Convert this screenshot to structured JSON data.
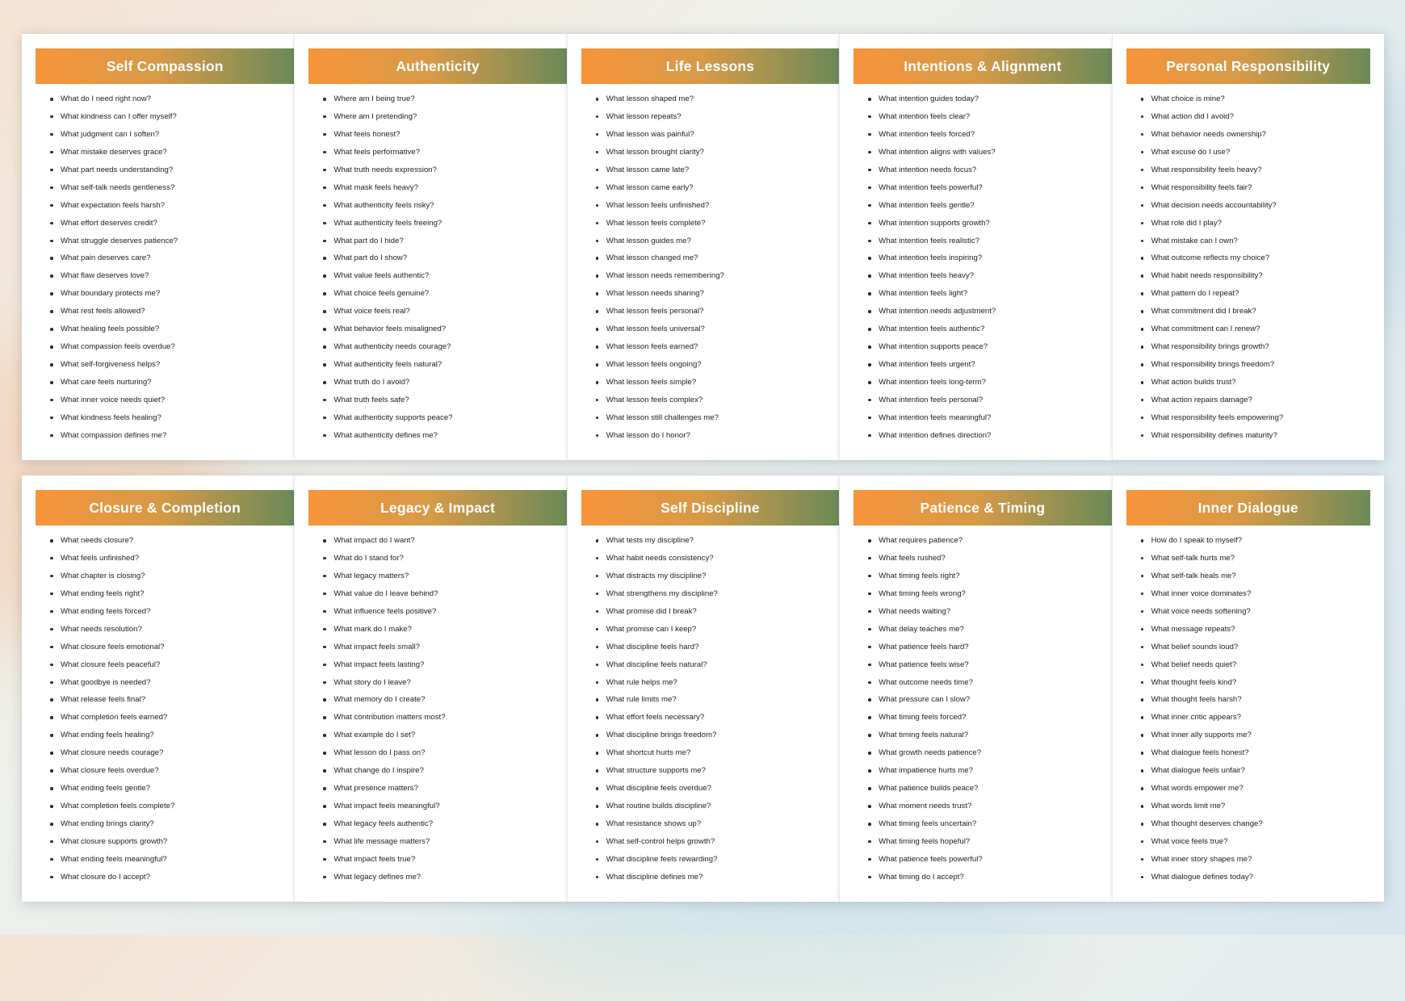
{
  "pages": [
    {
      "title": "Self Compassion",
      "questions": [
        "What do I need right now?",
        "What kindness can I offer myself?",
        "What judgment can I soften?",
        "What mistake deserves grace?",
        "What part needs understanding?",
        "What self-talk needs gentleness?",
        "What expectation feels harsh?",
        "What effort deserves credit?",
        "What struggle deserves patience?",
        "What pain deserves care?",
        "What flaw deserves love?",
        "What boundary protects me?",
        "What rest feels allowed?",
        "What healing feels possible?",
        "What compassion feels overdue?",
        "What self-forgiveness helps?",
        "What care feels nurturing?",
        "What inner voice needs quiet?",
        "What kindness feels healing?",
        "What compassion defines me?"
      ]
    },
    {
      "title": "Authenticity",
      "questions": [
        "Where am I being true?",
        "Where am I pretending?",
        "What feels honest?",
        "What feels performative?",
        "What truth needs expression?",
        "What mask feels heavy?",
        "What authenticity feels risky?",
        "What authenticity feels freeing?",
        "What part do I hide?",
        "What part do I show?",
        "What value feels authentic?",
        "What choice feels genuine?",
        "What voice feels real?",
        "What behavior feels misaligned?",
        "What authenticity needs courage?",
        "What authenticity feels natural?",
        "What truth do I avoid?",
        "What truth feels safe?",
        "What authenticity supports peace?",
        "What authenticity defines me?"
      ]
    },
    {
      "title": "Life Lessons",
      "questions": [
        "What lesson shaped me?",
        "What lesson repeats?",
        "What lesson was painful?",
        "What lesson brought clarity?",
        "What lesson came late?",
        "What lesson came early?",
        "What lesson feels unfinished?",
        "What lesson feels complete?",
        "What lesson guides me?",
        "What lesson changed me?",
        "What lesson needs remembering?",
        "What lesson needs sharing?",
        "What lesson feels personal?",
        "What lesson feels universal?",
        "What lesson feels earned?",
        "What lesson feels ongoing?",
        "What lesson feels simple?",
        "What lesson feels complex?",
        "What lesson still challenges me?",
        "What lesson do I honor?"
      ]
    },
    {
      "title": "Intentions & Alignment",
      "questions": [
        "What intention guides today?",
        "What intention feels clear?",
        "What intention feels forced?",
        "What intention aligns with values?",
        "What intention needs focus?",
        "What intention feels powerful?",
        "What intention feels gentle?",
        "What intention supports growth?",
        "What intention feels realistic?",
        "What intention feels inspiring?",
        "What intention feels heavy?",
        "What intention feels light?",
        "What intention needs adjustment?",
        "What intention feels authentic?",
        "What intention supports peace?",
        "What intention feels urgent?",
        "What intention feels long-term?",
        "What intention feels personal?",
        "What intention feels meaningful?",
        "What intention defines direction?"
      ]
    },
    {
      "title": "Personal Responsibility",
      "questions": [
        "What choice is mine?",
        "What action did I avoid?",
        "What behavior needs ownership?",
        "What excuse do I use?",
        "What responsibility feels heavy?",
        "What responsibility feels fair?",
        "What decision needs accountability?",
        "What role did I play?",
        "What mistake can I own?",
        "What outcome reflects my choice?",
        "What habit needs responsibility?",
        "What pattern do I repeat?",
        "What commitment did I break?",
        "What commitment can I renew?",
        "What responsibility brings growth?",
        "What responsibility brings freedom?",
        "What action builds trust?",
        "What action repairs damage?",
        "What responsibility feels empowering?",
        "What responsibility defines maturity?"
      ]
    },
    {
      "title": "Closure & Completion",
      "questions": [
        "What needs closure?",
        "What feels unfinished?",
        "What chapter is closing?",
        "What ending feels right?",
        "What ending feels forced?",
        "What needs resolution?",
        "What closure feels emotional?",
        "What closure feels peaceful?",
        "What goodbye is needed?",
        "What release feels final?",
        "What completion feels earned?",
        "What ending feels healing?",
        "What closure needs courage?",
        "What closure feels overdue?",
        "What ending feels gentle?",
        "What completion feels complete?",
        "What ending brings clarity?",
        "What closure supports growth?",
        "What ending feels meaningful?",
        "What closure do I accept?"
      ]
    },
    {
      "title": "Legacy & Impact",
      "questions": [
        "What impact do I want?",
        "What do I stand for?",
        "What legacy matters?",
        "What value do I leave behind?",
        "What influence feels positive?",
        "What mark do I make?",
        "What impact feels small?",
        "What impact feels lasting?",
        "What story do I leave?",
        "What memory do I create?",
        "What contribution matters most?",
        "What example do I set?",
        "What lesson do I pass on?",
        "What change do I inspire?",
        "What presence matters?",
        "What impact feels meaningful?",
        "What legacy feels authentic?",
        "What life message matters?",
        "What impact feels true?",
        "What legacy defines me?"
      ]
    },
    {
      "title": "Self Discipline",
      "questions": [
        "What tests my discipline?",
        "What habit needs consistency?",
        "What distracts my discipline?",
        "What strengthens my discipline?",
        "What promise did I break?",
        "What promise can I keep?",
        "What discipline feels hard?",
        "What discipline feels natural?",
        "What rule helps me?",
        "What rule limits me?",
        "What effort feels necessary?",
        "What discipline brings freedom?",
        "What shortcut hurts me?",
        "What structure supports me?",
        "What discipline feels overdue?",
        "What routine builds discipline?",
        "What resistance shows up?",
        "What self-control helps growth?",
        "What discipline feels rewarding?",
        "What discipline defines me?"
      ]
    },
    {
      "title": "Patience & Timing",
      "questions": [
        "What requires patience?",
        "What feels rushed?",
        "What timing feels right?",
        "What timing feels wrong?",
        "What needs waiting?",
        "What delay teaches me?",
        "What patience feels hard?",
        "What patience feels wise?",
        "What outcome needs time?",
        "What pressure can I slow?",
        "What timing feels forced?",
        "What timing feels natural?",
        "What growth needs patience?",
        "What impatience hurts me?",
        "What patience builds peace?",
        "What moment needs trust?",
        "What timing feels uncertain?",
        "What timing feels hopeful?",
        "What patience feels powerful?",
        "What timing do I accept?"
      ]
    },
    {
      "title": "Inner Dialogue",
      "questions": [
        "How do I speak to myself?",
        "What self-talk hurts me?",
        "What self-talk heals me?",
        "What inner voice dominates?",
        "What voice needs softening?",
        "What message repeats?",
        "What belief sounds loud?",
        "What belief needs quiet?",
        "What thought feels kind?",
        "What thought feels harsh?",
        "What inner critic appears?",
        "What inner ally supports me?",
        "What dialogue feels honest?",
        "What dialogue feels unfair?",
        "What words empower me?",
        "What words limit me?",
        "What thought deserves change?",
        "What voice feels true?",
        "What inner story shapes me?",
        "What dialogue defines today?"
      ]
    }
  ]
}
